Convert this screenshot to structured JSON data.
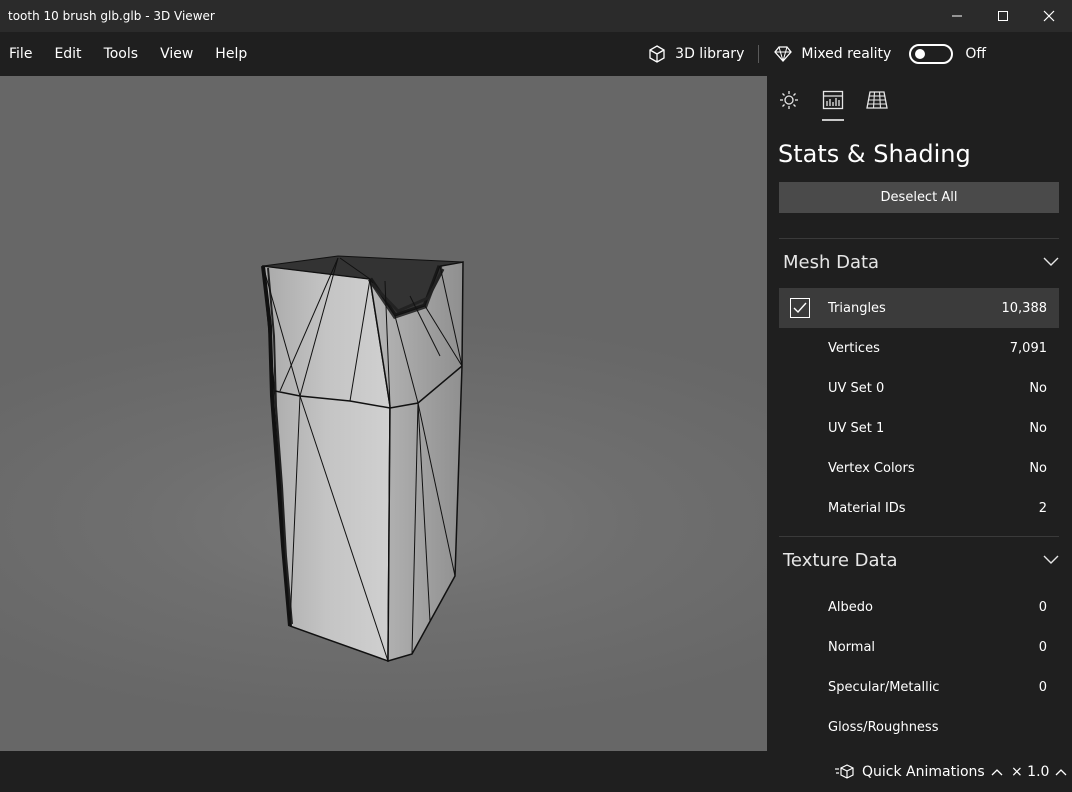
{
  "window": {
    "title": "tooth 10 brush glb.glb - 3D Viewer"
  },
  "menu": {
    "items": [
      "File",
      "Edit",
      "Tools",
      "View",
      "Help"
    ],
    "library_label": "3D library",
    "mixed_reality_label": "Mixed reality",
    "mixed_reality_state": "Off"
  },
  "panel": {
    "title": "Stats & Shading",
    "deselect_label": "Deselect All",
    "mesh_section": "Mesh Data",
    "mesh_rows": [
      {
        "name": "Triangles",
        "value": "10,388"
      },
      {
        "name": "Vertices",
        "value": "7,091"
      },
      {
        "name": "UV Set 0",
        "value": "No"
      },
      {
        "name": "UV Set 1",
        "value": "No"
      },
      {
        "name": "Vertex Colors",
        "value": "No"
      },
      {
        "name": "Material IDs",
        "value": "2"
      }
    ],
    "texture_section": "Texture Data",
    "texture_rows": [
      {
        "name": "Albedo",
        "value": "0"
      },
      {
        "name": "Normal",
        "value": "0"
      },
      {
        "name": "Specular/Metallic",
        "value": "0"
      },
      {
        "name": "Gloss/Roughness",
        "value": ""
      }
    ]
  },
  "status": {
    "animations_label": "Quick Animations",
    "speed_label": "× 1.0"
  },
  "colors": {
    "background": "#1f1f1f",
    "titlebar": "#2b2b2b",
    "viewport": "#6f6f6f",
    "button": "#4a4a4a"
  }
}
